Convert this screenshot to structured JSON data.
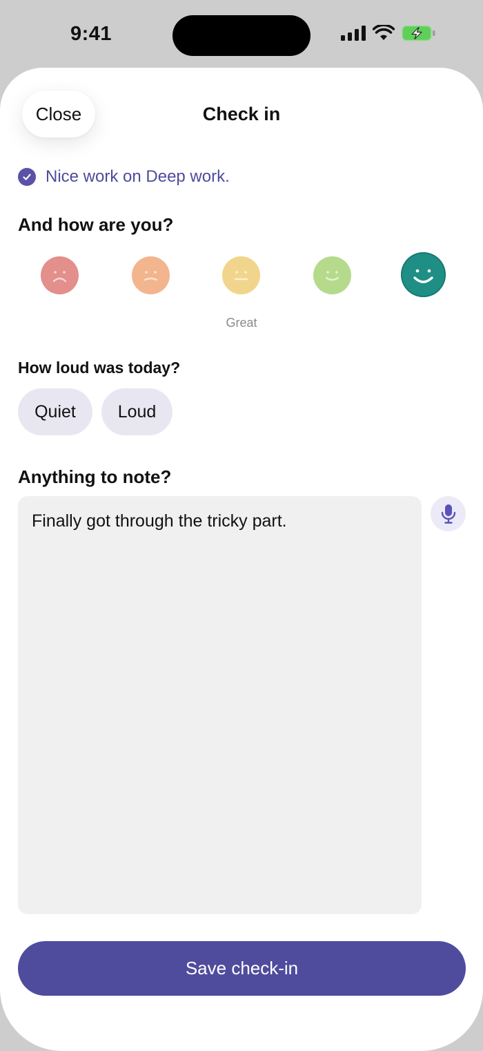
{
  "status_bar": {
    "time": "9:41",
    "icons": [
      "cellular-signal-icon",
      "wifi-icon",
      "battery-charging-icon"
    ]
  },
  "header": {
    "close_label": "Close",
    "title": "Check in"
  },
  "confirmation": {
    "icon": "check-circle-icon",
    "text": "Nice work on Deep work."
  },
  "mood": {
    "question": "And how are you?",
    "options": [
      {
        "icon": "very-sad-face-icon",
        "color": "#e38f8c"
      },
      {
        "icon": "sad-face-icon",
        "color": "#f3b58e"
      },
      {
        "icon": "neutral-face-icon",
        "color": "#f2d58c"
      },
      {
        "icon": "happy-face-icon",
        "color": "#b5da8c"
      },
      {
        "icon": "very-happy-face-icon",
        "color": "#1f8f86"
      }
    ],
    "selected_index": 4,
    "selected_label": "Great"
  },
  "loudness": {
    "question": "How loud was today?",
    "options": [
      "Quiet",
      "Loud"
    ]
  },
  "note": {
    "question": "Anything to note?",
    "value": "Finally got through the tricky part.",
    "mic_icon": "microphone-icon"
  },
  "save_label": "Save check-in",
  "colors": {
    "accent": "#4f4c9e",
    "selected_mood": "#1f8f86",
    "chip_bg": "#e8e7f1",
    "note_bg": "#f0f0f0"
  }
}
